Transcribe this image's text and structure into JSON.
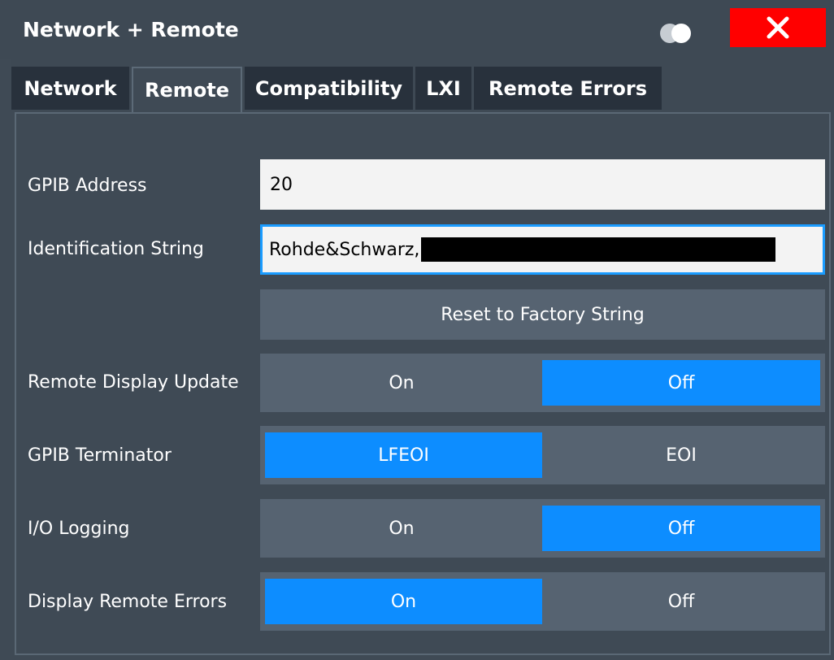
{
  "window": {
    "title": "Network + Remote",
    "toggle_icon": "toggle-icon",
    "close_icon": "close-icon"
  },
  "tabs": [
    {
      "label": "Network"
    },
    {
      "label": "Remote"
    },
    {
      "label": "Compatibility"
    },
    {
      "label": "LXI"
    },
    {
      "label": "Remote Errors"
    }
  ],
  "active_tab": "Remote",
  "fields": {
    "gpib_address": {
      "label": "GPIB Address",
      "value": "20"
    },
    "identification_string": {
      "label": "Identification String",
      "value": "Rohde&Schwarz,"
    },
    "reset_button": {
      "label": "Reset to Factory String"
    }
  },
  "toggles": {
    "remote_display_update": {
      "label": "Remote Display Update",
      "options": [
        "On",
        "Off"
      ],
      "selected": "Off"
    },
    "gpib_terminator": {
      "label": "GPIB Terminator",
      "options": [
        "LFEOI",
        "EOI"
      ],
      "selected": "LFEOI"
    },
    "io_logging": {
      "label": "I/O Logging",
      "options": [
        "On",
        "Off"
      ],
      "selected": "Off"
    },
    "display_remote_errors": {
      "label": "Display Remote Errors",
      "options": [
        "On",
        "Off"
      ],
      "selected": "On"
    }
  },
  "colors": {
    "close_button": "#ff0000",
    "selected_option": "#0d8dff",
    "panel_background": "#3f4a55",
    "control_background": "#566371"
  }
}
